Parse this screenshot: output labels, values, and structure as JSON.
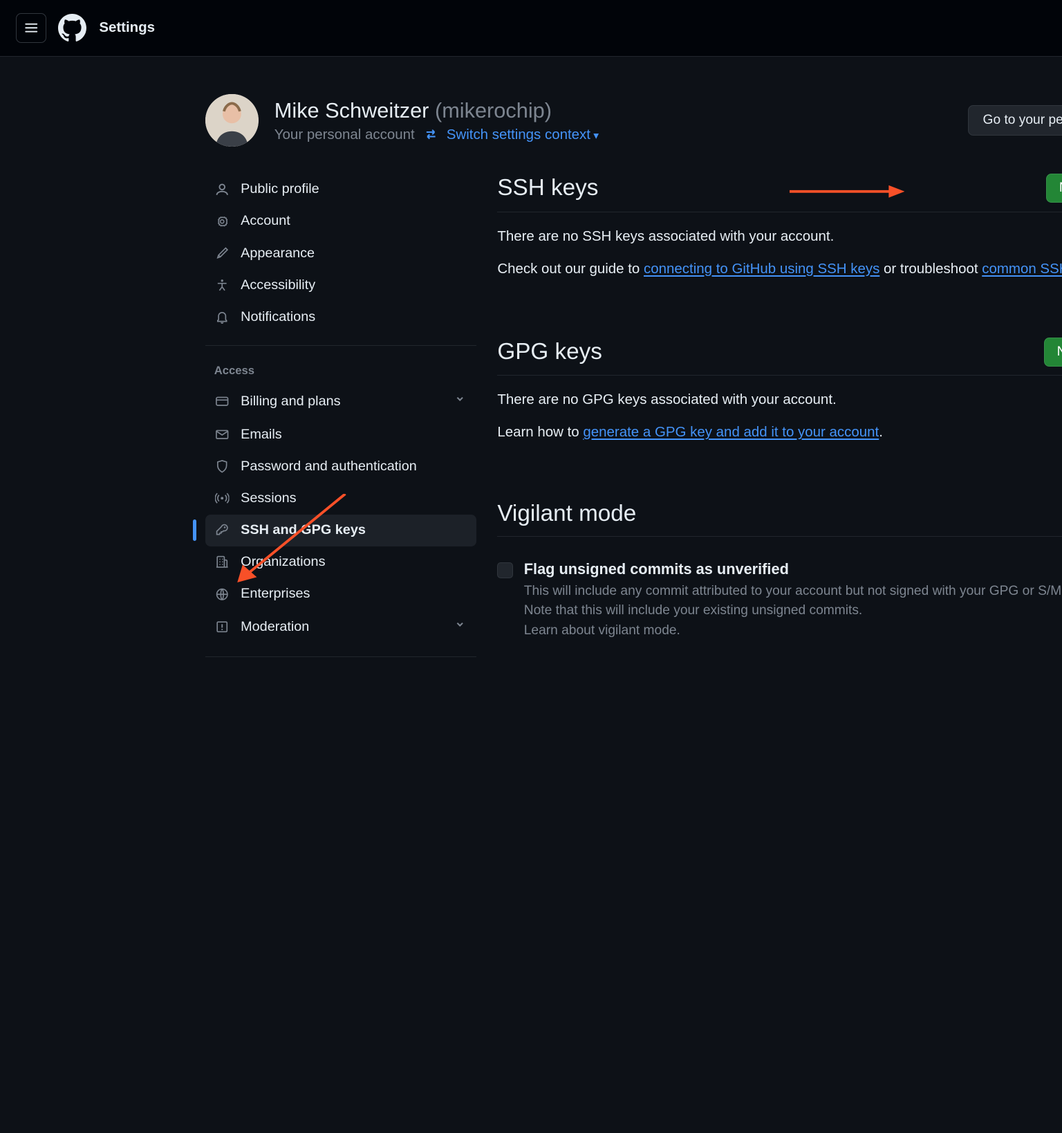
{
  "top": {
    "title": "Settings"
  },
  "header": {
    "display_name": "Mike Schweitzer",
    "username": "(mikerochip)",
    "subtitle": "Your personal account",
    "switch_label": "Switch settings context",
    "profile_btn": "Go to your personal profile"
  },
  "sidebar": {
    "group1": [
      {
        "label": "Public profile",
        "icon": "person"
      },
      {
        "label": "Account",
        "icon": "gear"
      },
      {
        "label": "Appearance",
        "icon": "brush"
      },
      {
        "label": "Accessibility",
        "icon": "accessibility"
      },
      {
        "label": "Notifications",
        "icon": "bell"
      }
    ],
    "access_title": "Access",
    "group2": [
      {
        "label": "Billing and plans",
        "icon": "card",
        "expand": true
      },
      {
        "label": "Emails",
        "icon": "mail"
      },
      {
        "label": "Password and authentication",
        "icon": "shield"
      },
      {
        "label": "Sessions",
        "icon": "broadcast"
      },
      {
        "label": "SSH and GPG keys",
        "icon": "key",
        "active": true
      },
      {
        "label": "Organizations",
        "icon": "org"
      },
      {
        "label": "Enterprises",
        "icon": "globe"
      },
      {
        "label": "Moderation",
        "icon": "report",
        "expand": true
      }
    ]
  },
  "main": {
    "ssh": {
      "title": "SSH keys",
      "button": "New SSH key",
      "empty": "There are no SSH keys associated with your account.",
      "guide_pre": "Check out our guide to ",
      "guide_link": "connecting to GitHub using SSH keys",
      "guide_mid": " or troubleshoot ",
      "guide_link2": "common SSH problems",
      "guide_end": "."
    },
    "gpg": {
      "title": "GPG keys",
      "button": "New GPG key",
      "empty": "There are no GPG keys associated with your account.",
      "learn_pre": "Learn how to ",
      "learn_link": "generate a GPG key and add it to your account",
      "learn_end": "."
    },
    "vigilant": {
      "title": "Vigilant mode",
      "flag_label": "Flag unsigned commits as unverified",
      "desc1": "This will include any commit attributed to your account but not signed with your GPG or S/MIME key.",
      "desc2": "Note that this will include your existing unsigned commits.",
      "learn_link": "Learn about vigilant mode",
      "learn_end": "."
    }
  }
}
